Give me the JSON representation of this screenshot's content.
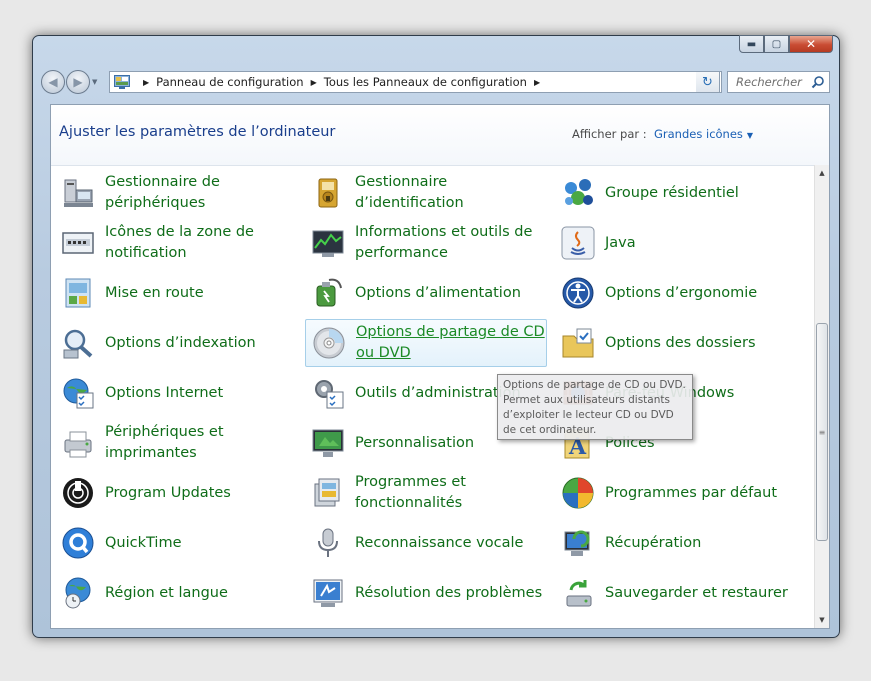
{
  "window": {
    "buttons": {
      "minimize": "▬",
      "maximize": "▢",
      "close": "✕"
    }
  },
  "address_bar": {
    "breadcrumbs": [
      "Panneau de configuration",
      "Tous les Panneaux de configuration"
    ]
  },
  "search": {
    "placeholder": "Rechercher"
  },
  "header": {
    "title": "Ajuster les paramètres de l’ordinateur",
    "view_label": "Afficher par :",
    "view_value": "Grandes icônes"
  },
  "items": [
    {
      "label": "Gestionnaire de périphériques",
      "icon": "device-manager-icon"
    },
    {
      "label": "Gestionnaire d’identification",
      "icon": "credential-manager-icon"
    },
    {
      "label": "Groupe résidentiel",
      "icon": "homegroup-icon"
    },
    {
      "label": "Icônes de la zone de notification",
      "icon": "notification-icons-icon"
    },
    {
      "label": "Informations et outils de performance",
      "icon": "performance-icon"
    },
    {
      "label": "Java",
      "icon": "java-icon"
    },
    {
      "label": "Mise en route",
      "icon": "getting-started-icon"
    },
    {
      "label": "Options d’alimentation",
      "icon": "power-options-icon"
    },
    {
      "label": "Options d’ergonomie",
      "icon": "ease-of-access-icon"
    },
    {
      "label": "Options d’indexation",
      "icon": "indexing-options-icon"
    },
    {
      "label": "Options de partage de CD ou DVD",
      "icon": "cd-dvd-icon"
    },
    {
      "label": "Options des dossiers",
      "icon": "folder-options-icon"
    },
    {
      "label": "Options Internet",
      "icon": "internet-options-icon"
    },
    {
      "label": "Outils d’administration",
      "icon": "admin-tools-icon"
    },
    {
      "label": "Pare-feu Windows",
      "icon": "firewall-icon"
    },
    {
      "label": "Périphériques et imprimantes",
      "icon": "devices-printers-icon"
    },
    {
      "label": "Personnalisation",
      "icon": "personalization-icon"
    },
    {
      "label": "Polices",
      "icon": "fonts-icon"
    },
    {
      "label": "Program Updates",
      "icon": "program-updates-icon"
    },
    {
      "label": "Programmes et fonctionnalités",
      "icon": "programs-features-icon"
    },
    {
      "label": "Programmes par défaut",
      "icon": "default-programs-icon"
    },
    {
      "label": "QuickTime",
      "icon": "quicktime-icon"
    },
    {
      "label": "Reconnaissance vocale",
      "icon": "speech-recognition-icon"
    },
    {
      "label": "Récupération",
      "icon": "recovery-icon"
    },
    {
      "label": "Région et langue",
      "icon": "region-language-icon"
    },
    {
      "label": "Résolution des problèmes",
      "icon": "troubleshooting-icon"
    },
    {
      "label": "Sauvegarder et restaurer",
      "icon": "backup-restore-icon"
    }
  ],
  "tooltip": {
    "text": "Options de partage de CD ou DVD. Permet aux utilisateurs distants d’exploiter le lecteur CD ou DVD de cet ordinateur."
  }
}
